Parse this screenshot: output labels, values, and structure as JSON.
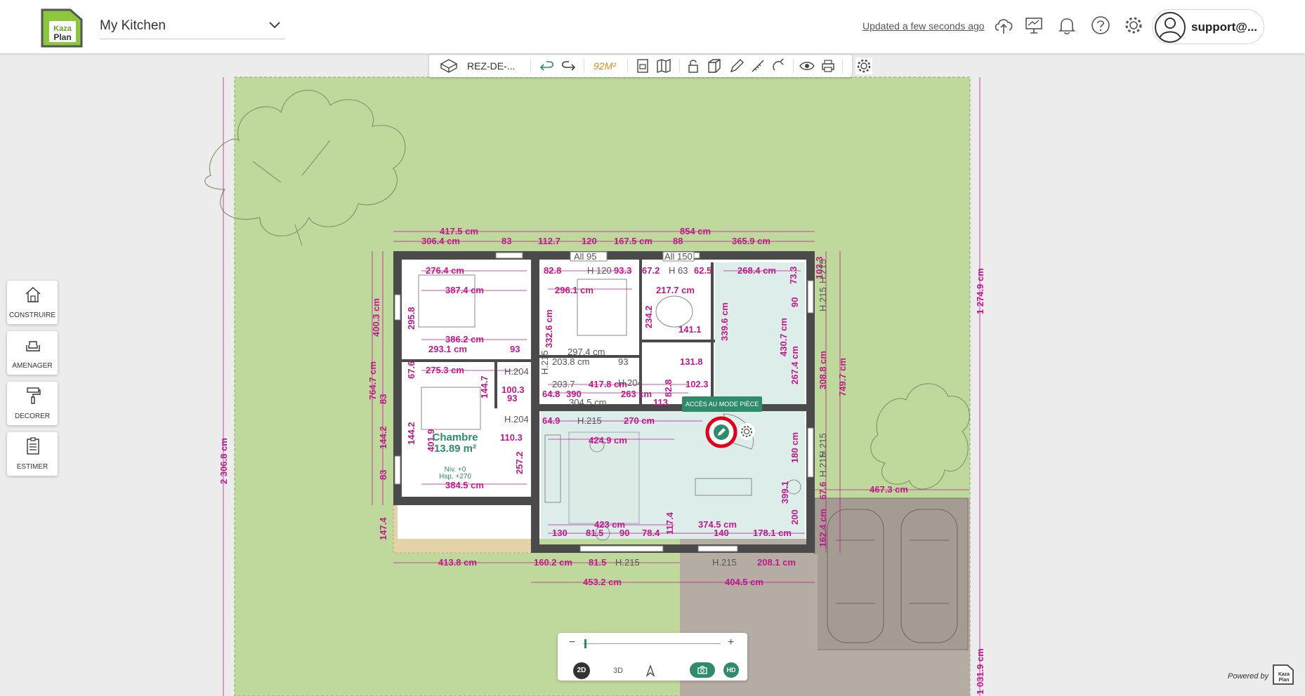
{
  "header": {
    "logo_text": "Kaza Plan",
    "project_name": "My Kitchen",
    "updated": "Updated a few seconds ago",
    "user": "support@..."
  },
  "toolbar": {
    "level": "REZ-DE-...",
    "area": "92M²"
  },
  "left_tools": [
    {
      "label": "CONSTRUIRE",
      "icon": "house-icon"
    },
    {
      "label": "AMENAGER",
      "icon": "sofa-icon"
    },
    {
      "label": "DECORER",
      "icon": "paint-roller-icon"
    },
    {
      "label": "ESTIMER",
      "icon": "clipboard-icon"
    }
  ],
  "tooltip": "ACCÈS AU MODE PIÈCE",
  "room": {
    "name": "Chambre",
    "area": "13.89 m²",
    "niv": "Niv. +0",
    "hsp": "Hsp. +270"
  },
  "zoom": {
    "minus": "−",
    "plus": "+",
    "level": 0.01,
    "mode_2d": "2D",
    "mode_3d": "3D",
    "hd": "HD"
  },
  "powered_by": "Powered by",
  "colors": {
    "brand_green": "#8dc63f",
    "accent_teal": "#2e8c6b",
    "dimension": "#c0198c",
    "garden": "#bfd99d",
    "wall": "#4a4a4a"
  },
  "plan_labels": {
    "wall_labels": [
      "All 95",
      "All 150"
    ],
    "heights": [
      "H 120",
      "H 63",
      "H.215",
      "H.204",
      "H.204",
      "H.204",
      "H.215",
      "H.215",
      "H.215",
      "H.215",
      "H.215"
    ],
    "dims_top": [
      "417.5 cm",
      "854 cm",
      "306.4 cm",
      "83",
      "112.7",
      "120",
      "167.5 cm",
      "88",
      "365.9 cm"
    ],
    "dims_left": [
      "400.3 cm",
      "764.7 cm",
      "83",
      "144.2",
      "83",
      "147.4",
      "2 306.8 cm"
    ],
    "dims_right": [
      "103.3",
      "73.3",
      "430.7 cm",
      "308.8 cm",
      "749.7 cm",
      "1 274.9 cm",
      "1 031.9 cm",
      "162.4 cm",
      "67.6",
      "180 cm",
      "200",
      "90",
      "267.4 cm"
    ],
    "dims_bottom": [
      "413.8 cm",
      "160.2 cm",
      "81.5",
      "H.215",
      "H.215",
      "208.1 cm",
      "453.2 cm",
      "404.5 cm",
      "467.3 cm"
    ],
    "dims_inner": [
      "276.4 cm",
      "387.4 cm",
      "386.2 cm",
      "293.1 cm",
      "93",
      "275.3 cm",
      "82.8",
      "93.3",
      "296.1 cm",
      "67.2",
      "62.5",
      "268.4 cm",
      "217.7 cm",
      "141.1",
      "297.4 cm",
      "203.8 cm",
      "93",
      "131.8",
      "203.7",
      "417.8 cm",
      "263 cm",
      "102.3",
      "304.5 cm",
      "113",
      "64.8",
      "390",
      "64.9",
      "270 cm",
      "424.9 cm",
      "110.3",
      "384.5 cm",
      "423 cm",
      "374.5 cm",
      "130",
      "81.5",
      "90",
      "78.4",
      "140",
      "178.1 cm",
      "295.8",
      "332.6 cm",
      "234.2",
      "339.6 cm",
      "401.9",
      "257.2",
      "144.7",
      "144.2",
      "117.4",
      "82.8",
      "67.6",
      "100.3",
      "93",
      "399.1"
    ]
  }
}
